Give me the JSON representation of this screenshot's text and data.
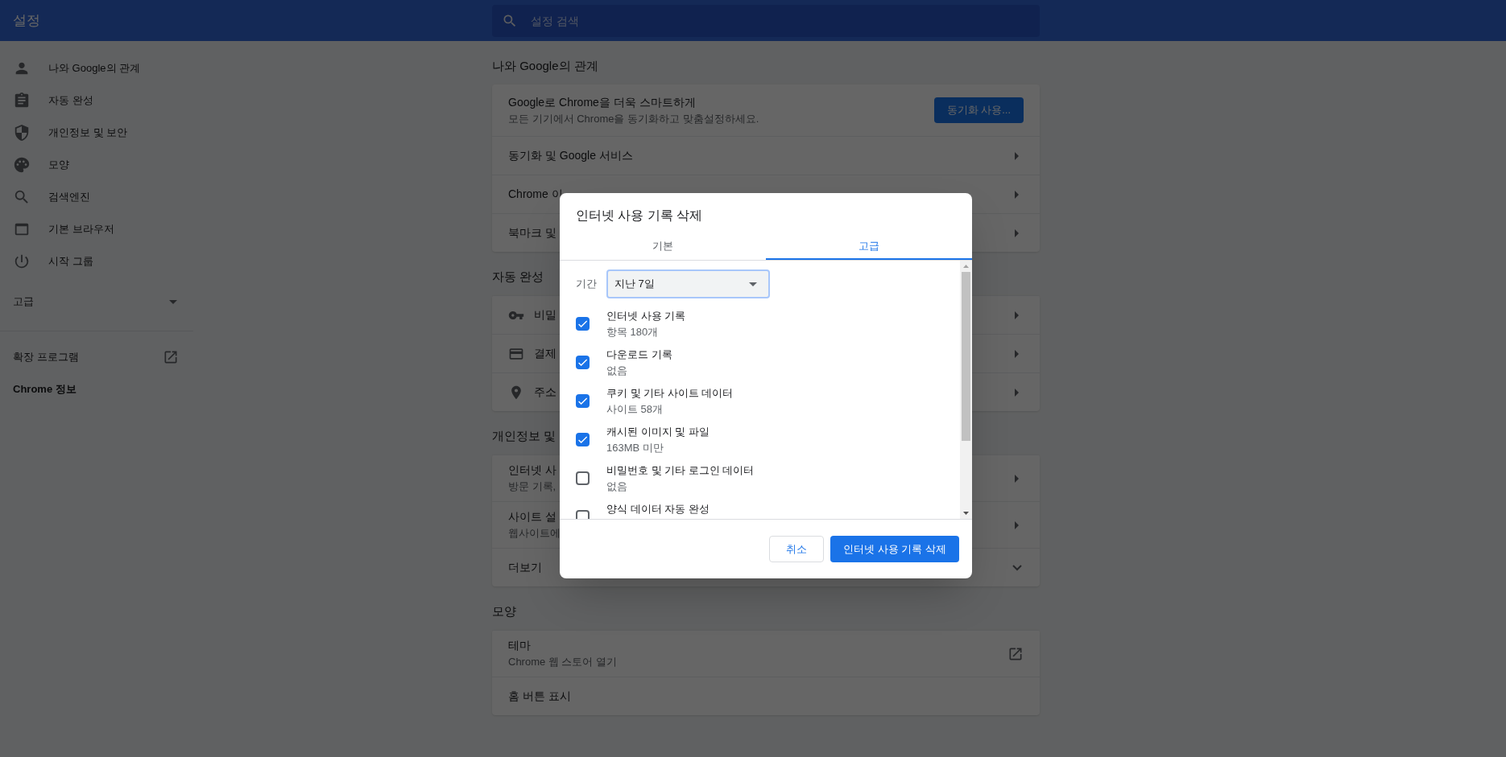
{
  "header": {
    "title": "설정",
    "search_placeholder": "설정 검색"
  },
  "sidebar": {
    "items": [
      {
        "label": "나와 Google의 관계"
      },
      {
        "label": "자동 완성"
      },
      {
        "label": "개인정보 및 보안"
      },
      {
        "label": "모양"
      },
      {
        "label": "검색엔진"
      },
      {
        "label": "기본 브라우저"
      },
      {
        "label": "시작 그룹"
      }
    ],
    "advanced": {
      "label": "고급",
      "expanded": false
    },
    "extensions": "확장 프로그램",
    "about": "Chrome 정보"
  },
  "sections": [
    {
      "title": "나와 Google의 관계",
      "rows": [
        {
          "kind": "promo",
          "title": "Google로 Chrome을 더욱 스마트하게",
          "subtitle": "모든 기기에서 Chrome을 동기화하고 맞춤설정하세요.",
          "button": "동기화 사용..."
        },
        {
          "kind": "arrow",
          "title": "동기화 및 Google 서비스"
        },
        {
          "kind": "arrow",
          "title": "Chrome 이"
        },
        {
          "kind": "arrow",
          "title": "북마크 및"
        }
      ]
    },
    {
      "title": "자동 완성",
      "rows": [
        {
          "kind": "arrow",
          "title": "비밀"
        },
        {
          "kind": "arrow",
          "title": "결제"
        },
        {
          "kind": "arrow",
          "title": "주소"
        }
      ]
    },
    {
      "title": "개인정보 및",
      "rows": [
        {
          "kind": "arrow",
          "title": "인터넷 사",
          "subtitle": "방문 기록,"
        },
        {
          "kind": "arrow",
          "title": "사이트 설",
          "subtitle": "웹사이트에"
        },
        {
          "kind": "expand",
          "title": "더보기"
        }
      ]
    },
    {
      "title": "모양",
      "rows": [
        {
          "kind": "external",
          "title": "테마",
          "subtitle": "Chrome 웹 스토어 열기"
        },
        {
          "kind": "plain",
          "title": "홈 버튼 표시"
        }
      ]
    }
  ],
  "dialog": {
    "title": "인터넷 사용 기록 삭제",
    "tabs": [
      {
        "label": "기본",
        "selected": false
      },
      {
        "label": "고급",
        "selected": true
      }
    ],
    "period": {
      "label": "기간",
      "value": "지난 7일"
    },
    "items": [
      {
        "label": "인터넷 사용 기록",
        "detail": "항목 180개",
        "checked": true
      },
      {
        "label": "다운로드 기록",
        "detail": "없음",
        "checked": true
      },
      {
        "label": "쿠키 및 기타 사이트 데이터",
        "detail": "사이트 58개",
        "checked": true
      },
      {
        "label": "캐시된 이미지 및 파일",
        "detail": "163MB 미만",
        "checked": true
      },
      {
        "label": "비밀번호 및 기타 로그인 데이터",
        "detail": "없음",
        "checked": false
      },
      {
        "label": "양식 데이터 자동 완성",
        "checked": false
      }
    ],
    "cancel": "취소",
    "confirm": "인터넷 사용 기록 삭제"
  }
}
